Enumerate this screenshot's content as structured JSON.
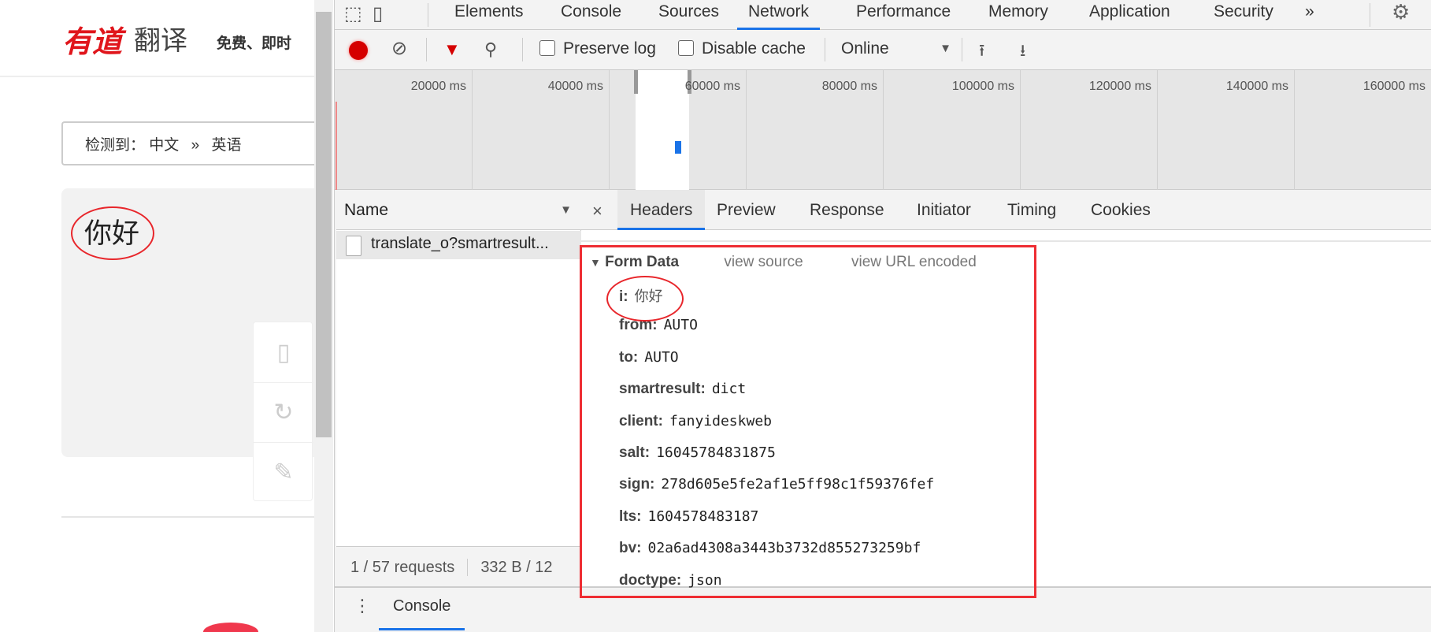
{
  "page": {
    "logo_text": "有道",
    "logo_suffix": "翻译",
    "slogan": "免费、即时",
    "detect": {
      "label": "检测到：",
      "from": "中文",
      "arrow": "»",
      "to": "英语"
    },
    "source_text": "你好",
    "side_icons": [
      "tablet-icon",
      "refresh-icon",
      "edit-icon"
    ]
  },
  "devtools": {
    "tabs": [
      "Elements",
      "Console",
      "Sources",
      "Network",
      "Performance",
      "Memory",
      "Application",
      "Security"
    ],
    "active_tab": "Network",
    "more": "»",
    "toolbar": {
      "preserve_log": "Preserve log",
      "disable_cache": "Disable cache",
      "throttle": "Online",
      "preserve_checked": false,
      "disable_checked": false
    },
    "timeline_ticks": [
      "20000 ms",
      "40000 ms",
      "60000 ms",
      "80000 ms",
      "100000 ms",
      "120000 ms",
      "140000 ms",
      "160000 ms"
    ],
    "name_header": "Name",
    "request": "translate_o?smartresult...",
    "status": {
      "requests": "1 / 57 requests",
      "size": "332 B / 12"
    },
    "detail_tabs": [
      "Headers",
      "Preview",
      "Response",
      "Initiator",
      "Timing",
      "Cookies"
    ],
    "active_detail_tab": "Headers",
    "close": "×",
    "form": {
      "title": "Form Data",
      "view_source": "view source",
      "view_url": "view URL encoded",
      "fields": [
        {
          "key": "i:",
          "value": "你好"
        },
        {
          "key": "from:",
          "value": "AUTO"
        },
        {
          "key": "to:",
          "value": "AUTO"
        },
        {
          "key": "smartresult:",
          "value": "dict"
        },
        {
          "key": "client:",
          "value": "fanyideskweb"
        },
        {
          "key": "salt:",
          "value": "16045784831875"
        },
        {
          "key": "sign:",
          "value": "278d605e5fe2af1e5ff98c1f59376fef"
        },
        {
          "key": "lts:",
          "value": "1604578483187"
        },
        {
          "key": "bv:",
          "value": "02a6ad4308a3443b3732d855273259bf"
        },
        {
          "key": "doctype:",
          "value": "json"
        }
      ]
    },
    "drawer_tab": "Console",
    "colors": {
      "accent": "#1a73e8",
      "record": "#d50000",
      "annotation": "#ee2d33"
    }
  }
}
